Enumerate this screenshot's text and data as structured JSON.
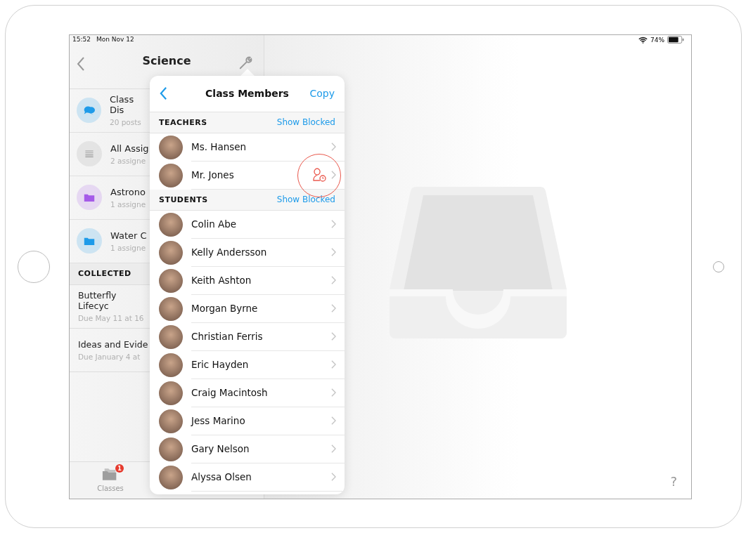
{
  "status_bar": {
    "time": "15:52",
    "date": "Mon Nov 12",
    "battery": "74%"
  },
  "sidebar": {
    "title": "Science",
    "items": [
      {
        "kind": "chat",
        "title": "Class Dis",
        "subtitle": "20 posts",
        "color": "#1e9be9"
      },
      {
        "kind": "list",
        "title": "All Assig",
        "subtitle": "2 assigne",
        "color": "#9a9a9a"
      },
      {
        "kind": "folder",
        "title": "Astrono",
        "subtitle": "1 assigne",
        "color": "#a55be8"
      },
      {
        "kind": "folder",
        "title": "Water C",
        "subtitle": "1 assigne",
        "color": "#1e9be9"
      }
    ],
    "collected": {
      "header": "COLLECTED",
      "items": [
        {
          "title": "Butterfly Lifecyc",
          "subtitle": "Due May 11 at 16"
        },
        {
          "title": "Ideas and Evide",
          "subtitle": "Due January 4 at"
        }
      ]
    },
    "tab_bar": [
      {
        "label": "Classes",
        "badge": "1"
      }
    ]
  },
  "popover": {
    "title": "Class Members",
    "action": "Copy",
    "sections": [
      {
        "header": "TEACHERS",
        "link": "Show Blocked",
        "members": [
          {
            "name": "Ms. Hansen",
            "pending": false
          },
          {
            "name": "Mr. Jones",
            "pending": true
          }
        ]
      },
      {
        "header": "STUDENTS",
        "link": "Show Blocked",
        "members": [
          {
            "name": "Colin Abe",
            "pending": false
          },
          {
            "name": "Kelly Andersson",
            "pending": false
          },
          {
            "name": "Keith Ashton",
            "pending": false
          },
          {
            "name": "Morgan Byrne",
            "pending": false
          },
          {
            "name": "Christian Ferris",
            "pending": false
          },
          {
            "name": "Eric Hayden",
            "pending": false
          },
          {
            "name": "Craig Macintosh",
            "pending": false
          },
          {
            "name": "Jess Marino",
            "pending": false
          },
          {
            "name": "Gary Nelson",
            "pending": false
          },
          {
            "name": "Alyssa Olsen",
            "pending": false
          }
        ]
      }
    ]
  },
  "help": "?"
}
